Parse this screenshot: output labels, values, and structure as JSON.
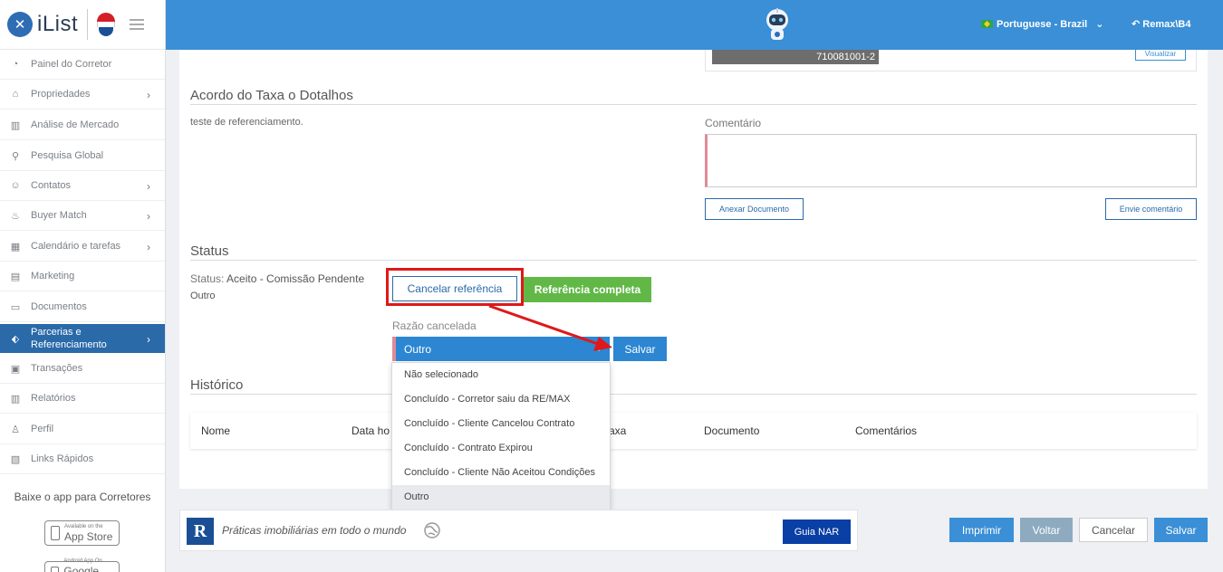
{
  "app": {
    "logo_text": "iList"
  },
  "sidebar": {
    "items": [
      {
        "label": "Painel do Corretor",
        "icon": "dashboard-icon",
        "has_chevron": false
      },
      {
        "label": "Propriedades",
        "icon": "home-icon",
        "has_chevron": true
      },
      {
        "label": "Análise de Mercado",
        "icon": "bar-chart-icon",
        "has_chevron": false
      },
      {
        "label": "Pesquisa Global",
        "icon": "search-icon",
        "has_chevron": false
      },
      {
        "label": "Contatos",
        "icon": "contacts-icon",
        "has_chevron": true
      },
      {
        "label": "Buyer Match",
        "icon": "fire-icon",
        "has_chevron": true
      },
      {
        "label": "Calendário e tarefas",
        "icon": "calendar-icon",
        "has_chevron": true
      },
      {
        "label": "Marketing",
        "icon": "newspaper-icon",
        "has_chevron": false
      },
      {
        "label": "Documentos",
        "icon": "folder-icon",
        "has_chevron": false
      },
      {
        "label": "Parcerias e Referenciamento",
        "icon": "tag-icon",
        "has_chevron": true,
        "active": true
      },
      {
        "label": "Transações",
        "icon": "briefcase-icon",
        "has_chevron": false
      },
      {
        "label": "Relatórios",
        "icon": "bar-chart-icon",
        "has_chevron": false
      },
      {
        "label": "Perfil",
        "icon": "user-icon",
        "has_chevron": false
      },
      {
        "label": "Links Rápidos",
        "icon": "links-icon",
        "has_chevron": false
      }
    ],
    "app_promo": "Baixe o app para Corretores",
    "app_store": {
      "small": "Available on the",
      "big": "App Store"
    },
    "google_play": {
      "small": "Android App On",
      "big": "Google Play"
    }
  },
  "topbar": {
    "language": "Portuguese - Brazil",
    "user": "Remax\\B4",
    "accent_color": "#3a8fd6"
  },
  "listing": {
    "thumbnail_id": "710081001-2",
    "view_label": "Visualizar"
  },
  "details": {
    "title": "Acordo do Taxa o Dotalhos",
    "text": "teste de referenciamento.",
    "comment_label": "Comentário",
    "attach_button": "Anexar Documento",
    "send_comment_button": "Envie comentário"
  },
  "status": {
    "title": "Status",
    "label": "Status:",
    "value": "Aceito - Comissão Pendente",
    "sub": "Outro",
    "cancel_button": "Cancelar referência",
    "complete_button": "Referência completa",
    "reason_label": "Razão cancelada",
    "reason_selected": "Outro",
    "save_button": "Salvar",
    "reason_options": [
      "Não selecionado",
      "Concluído - Corretor saiu da RE/MAX",
      "Concluído - Cliente Cancelou Contrato",
      "Concluído - Contrato Expirou",
      "Concluído - Cliente Não Aceitou Condições",
      "Outro"
    ]
  },
  "history": {
    "title": "Histórico",
    "columns": [
      "Nome",
      "Data ho",
      "axa",
      "Documento",
      "Comentários"
    ]
  },
  "footer": {
    "nar_logo": "R",
    "nar_text": "Práticas imobiliárias em todo o mundo",
    "guia_nar": "Guia NAR",
    "buttons": {
      "print": "Imprimir",
      "back": "Voltar",
      "cancel": "Cancelar",
      "save": "Salvar"
    }
  }
}
